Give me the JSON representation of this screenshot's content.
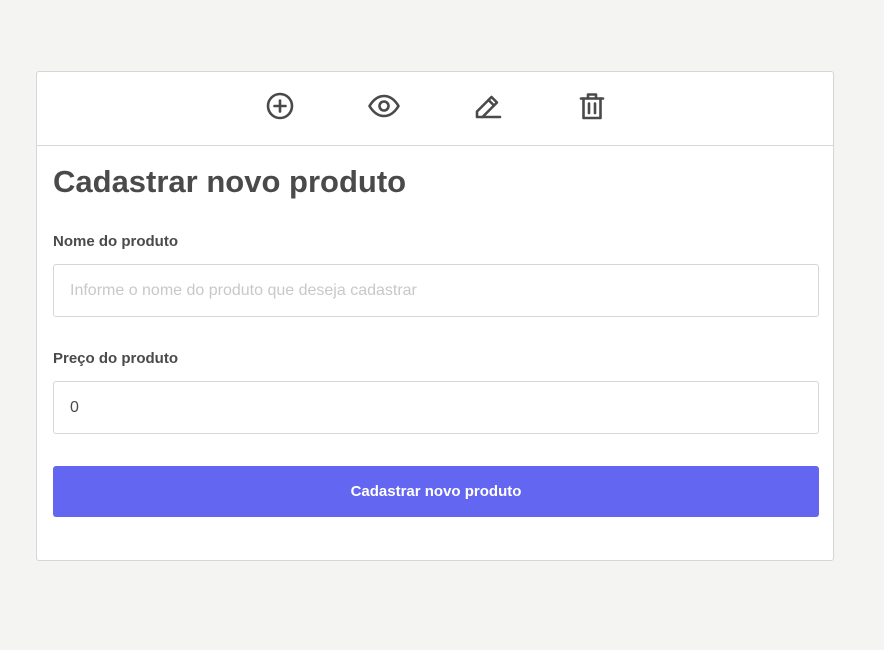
{
  "toolbar": {
    "icons": [
      "plus-circle-icon",
      "eye-icon",
      "pencil-icon",
      "trash-icon"
    ],
    "icon_color": "#4a4a4a"
  },
  "form": {
    "title": "Cadastrar novo produto",
    "name_label": "Nome do produto",
    "name_value": "",
    "name_placeholder": "Informe o nome do produto que deseja cadastrar",
    "price_label": "Preço do produto",
    "price_value": "0",
    "submit_label": "Cadastrar novo produto"
  },
  "colors": {
    "accent": "#6366f1",
    "background": "#f4f4f2",
    "text": "#4a4a4a",
    "border": "#d6d6d6"
  }
}
